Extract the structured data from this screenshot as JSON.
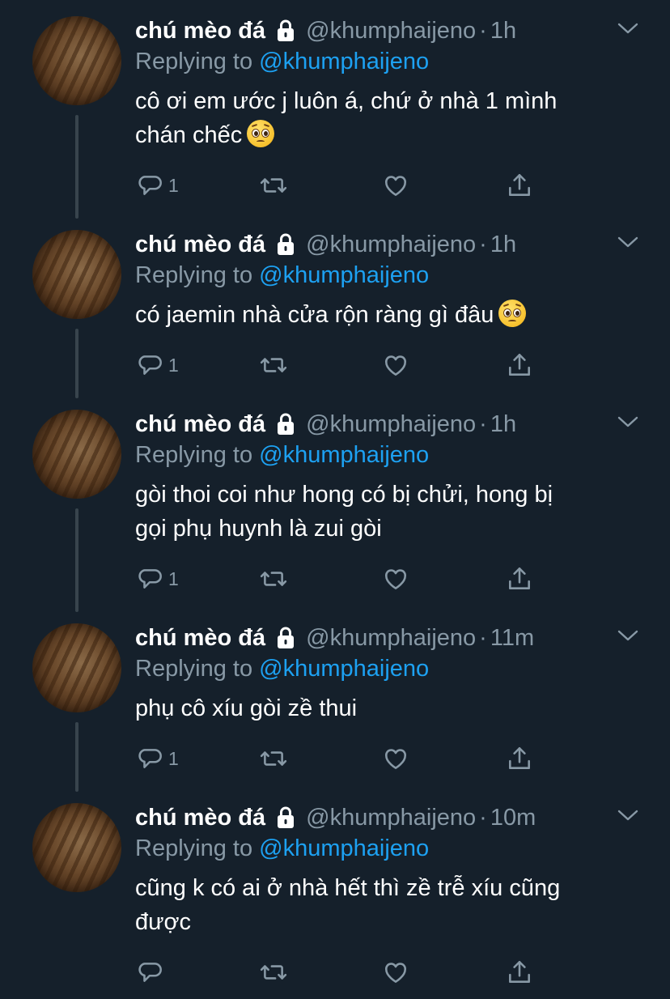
{
  "app": "Twitter",
  "theme": {
    "background": "#15202b",
    "text": "#ffffff",
    "secondary": "#8899a6",
    "accent": "#1da1f2",
    "thread_line": "#38444d"
  },
  "icons": {
    "lock": "lock-icon",
    "caret": "chevron-down-icon",
    "reply": "reply-icon",
    "retweet": "retweet-icon",
    "like": "heart-icon",
    "share": "share-icon",
    "emoji": "pleading-face-emoji"
  },
  "tweets": [
    {
      "name": "chú mèo đá",
      "handle": "@khumphaijeno",
      "separator": "·",
      "time": "1h",
      "replying_prefix": "Replying to",
      "replying_to": "@khumphaijeno",
      "text_lines": [
        "cô ơi em ước j luôn á, chứ ở nhà 1 mình",
        "chán chếc"
      ],
      "emoji": "🥺",
      "reply_count": "1"
    },
    {
      "name": "chú mèo đá",
      "handle": "@khumphaijeno",
      "separator": "·",
      "time": "1h",
      "replying_prefix": "Replying to",
      "replying_to": "@khumphaijeno",
      "text_lines": [
        "có jaemin nhà cửa rộn ràng gì đâu"
      ],
      "emoji": "🥺",
      "reply_count": "1"
    },
    {
      "name": "chú mèo đá",
      "handle": "@khumphaijeno",
      "separator": "·",
      "time": "1h",
      "replying_prefix": "Replying to",
      "replying_to": "@khumphaijeno",
      "text_lines": [
        "gòi thoi coi như hong có bị chửi, hong bị",
        "gọi phụ huynh là zui gòi"
      ],
      "emoji": "",
      "reply_count": "1"
    },
    {
      "name": "chú mèo đá",
      "handle": "@khumphaijeno",
      "separator": "·",
      "time": "11m",
      "replying_prefix": "Replying to",
      "replying_to": "@khumphaijeno",
      "text_lines": [
        "phụ cô xíu gòi zề thui"
      ],
      "emoji": "",
      "reply_count": "1"
    },
    {
      "name": "chú mèo đá",
      "handle": "@khumphaijeno",
      "separator": "·",
      "time": "10m",
      "replying_prefix": "Replying to",
      "replying_to": "@khumphaijeno",
      "text_lines": [
        "cũng k có ai ở nhà hết thì zề trễ xíu cũng",
        "được"
      ],
      "emoji": "",
      "reply_count": ""
    }
  ]
}
